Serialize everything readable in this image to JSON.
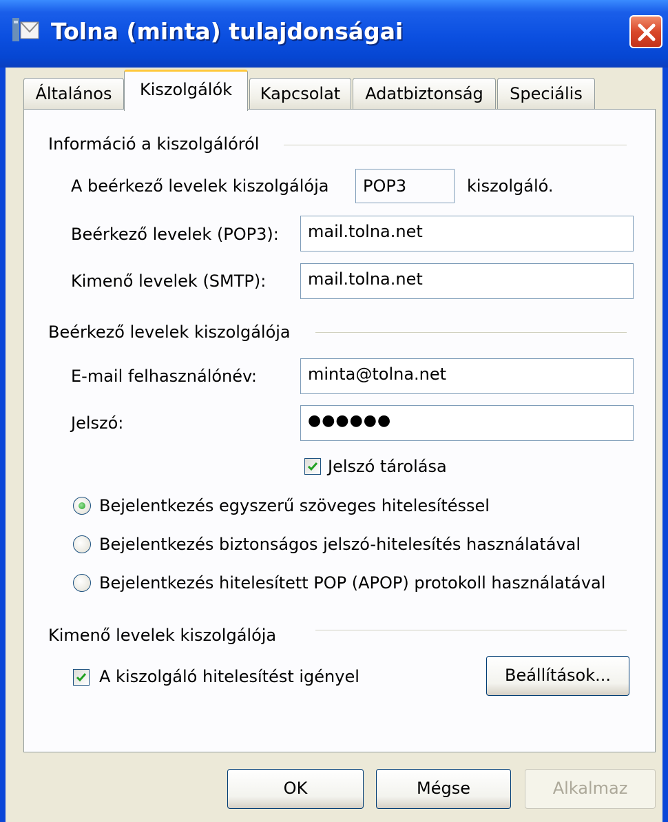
{
  "window": {
    "title": "Tolna (minta) tulajdonságai",
    "icons": {
      "title": "mail-account-icon",
      "close": "close-x-icon"
    },
    "colors": {
      "titlebar": "#0b4fe0",
      "close": "#d9492a",
      "active_tab_highlight": "#ffc83c",
      "check": "#21a121"
    }
  },
  "tabs": [
    {
      "label": "Általános",
      "active": false
    },
    {
      "label": "Kiszolgálók",
      "active": true
    },
    {
      "label": "Kapcsolat",
      "active": false
    },
    {
      "label": "Adatbiztonság",
      "active": false
    },
    {
      "label": "Speciális",
      "active": false
    }
  ],
  "server_info": {
    "heading": "Információ a kiszolgálóról",
    "incoming_type_label": "A beérkező levelek kiszolgálója",
    "incoming_type_value": "POP3",
    "incoming_type_suffix": "kiszolgáló.",
    "incoming_label": "Beérkező levelek (POP3):",
    "incoming_value": "mail.tolna.net",
    "outgoing_label": "Kimenő levelek (SMTP):",
    "outgoing_value": "mail.tolna.net"
  },
  "incoming_server": {
    "heading": "Beérkező levelek kiszolgálója",
    "username_label": "E-mail felhasználónév:",
    "username_value": "minta@tolna.net",
    "password_label": "Jelszó:",
    "password_value": "●●●●●●",
    "remember_password_label": "Jelszó tárolása",
    "remember_password_checked": true,
    "auth_options": [
      {
        "label": "Bejelentkezés egyszerű szöveges hitelesítéssel",
        "selected": true
      },
      {
        "label": "Bejelentkezés biztonságos jelszó-hitelesítés használatával",
        "selected": false
      },
      {
        "label": "Bejelentkezés hitelesített POP (APOP) protokoll használatával",
        "selected": false
      }
    ]
  },
  "outgoing_server": {
    "heading": "Kimenő levelek kiszolgálója",
    "requires_auth_label": "A kiszolgáló hitelesítést igényel",
    "requires_auth_checked": true,
    "settings_button": "Beállítások..."
  },
  "buttons": {
    "ok": "OK",
    "cancel": "Mégse",
    "apply": "Alkalmaz"
  }
}
